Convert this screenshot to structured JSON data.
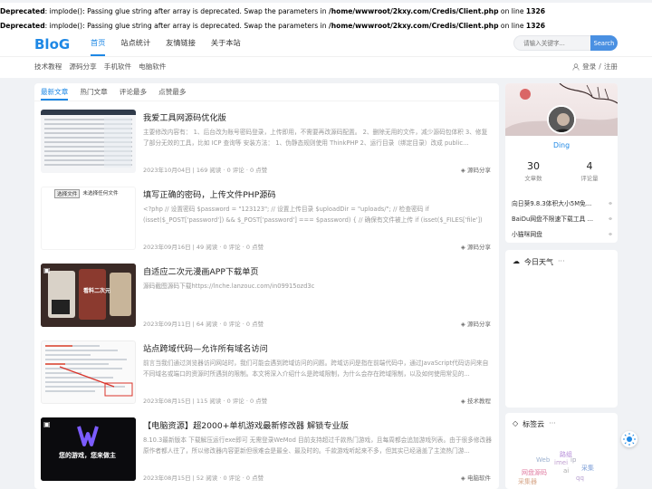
{
  "warnings": [
    {
      "label": "Deprecated",
      "text": ": implode(): Passing glue string after array is deprecated. Swap the parameters in ",
      "path": "/home/wwwroot/2kxy.com/Credis/Client.php",
      "online": " on line ",
      "line": "1326"
    },
    {
      "label": "Deprecated",
      "text": ": implode(): Passing glue string after array is deprecated. Swap the parameters in ",
      "path": "/home/wwwroot/2kxy.com/Credis/Client.php",
      "online": " on line ",
      "line": "1326"
    }
  ],
  "logo": "BloG",
  "nav": [
    "首页",
    "站点统计",
    "友情链接",
    "关于本站"
  ],
  "search": {
    "placeholder": "请输入关键字...",
    "button": "Search"
  },
  "subnav": [
    "技术教程",
    "源码分享",
    "手机软件",
    "电脑软件"
  ],
  "auth": {
    "login": "登录",
    "sep": "/",
    "register": "注册"
  },
  "tabs": [
    "最新文章",
    "热门文章",
    "评论最多",
    "点赞最多"
  ],
  "posts": [
    {
      "title": "我爱工具网源码优化版",
      "desc": "主要修改内容有：  1、后台改为账号密码登录，上传即用，不需要再改源码配置。 2、删除无用的文件，减少源码包体积 3、修复了部分无效的工具，比如 ICP 查询等 安装方法：  1、伪静态规则使用 ThinkPHP 2、运行目录（绑定目录）改成 public...",
      "date": "2023年10月04日",
      "views": "169 阅读",
      "comments": "0 评论",
      "likes": "0 点赞",
      "category": "源码分享"
    },
    {
      "title": "填写正确的密码，上传文件PHP源码",
      "desc": "<?php // 设置密码 $password = \"123123\"; // 设置上传目录 $uploadDir = \"uploads/\"; // 检查密码 if (isset($_POST['password']) && $_POST['password'] === $password) { // 确保有文件被上传 if (isset($_FILES['file']) && $_FILES['file']['error'] ===...",
      "date": "2023年09月16日",
      "views": "49 阅读",
      "comments": "0 评论",
      "likes": "0 点赞",
      "category": "源码分享",
      "thumb_btn": "选择文件",
      "thumb_text": "未选择任何文件"
    },
    {
      "title": "自适应二次元漫画APP下载单页",
      "desc": "源码截图源码下载https://lnche.lanzouc.com/in09915ozd3c",
      "date": "2023年09月11日",
      "views": "64 阅读",
      "comments": "0 评论",
      "likes": "0 点赞",
      "category": "源码分享",
      "thumb_text": "看料二次元"
    },
    {
      "title": "站点跨域代码—允许所有域名访问",
      "desc": "前言当我们通过浏览器访问网站时，我们可能会遇到跨域访问的问题。跨域访问是指在前端代码中，通过JavaScript代码访问来自不同域名或端口的资源时所遇到的限制。本文将深入介绍什么是跨域限制，为什么会存在跨域限制，以及如何使用常见的...",
      "date": "2023年08月15日",
      "views": "115 阅读",
      "comments": "0 评论",
      "likes": "0 点赞",
      "category": "技术教程"
    },
    {
      "title": "【电脑资源】超2000+单机游戏最新修改器 解锁专业版",
      "desc": "8.10.3最新版本 下载解压运行exe即可 无需登录WeMod 目前支持超过千款热门游戏，且每周都会追加游戏列表。由于很多修改器原作者都人往了，所以修改器内容更新但很难会是最全、最及时的。千款游戏听起来不多，但其实已经涵盖了主流热门游...",
      "date": "2023年08月15日",
      "views": "52 阅读",
      "comments": "0 评论",
      "likes": "0 点赞",
      "category": "电脑软件",
      "thumb_text": "您的游戏，您来做主"
    }
  ],
  "profile": {
    "name": "Ding",
    "articles": "30",
    "articles_label": "文章数",
    "comments": "4",
    "comments_label": "评论量"
  },
  "side_links": [
    "向日葵9.8.3体积大小5M免...",
    "BaiDu网盘不限速下载工具 ...",
    "小猫咪网盘"
  ],
  "weather": {
    "title": "今日天气",
    "more": "···"
  },
  "tagcloud": {
    "title": "标签云",
    "more": "···",
    "tags": [
      "路组",
      "Web",
      "采集",
      "网盘源码",
      "imei",
      "ai",
      "采集器",
      "qq",
      "ip"
    ]
  },
  "colors": {
    "accent": "#1e88e5"
  }
}
